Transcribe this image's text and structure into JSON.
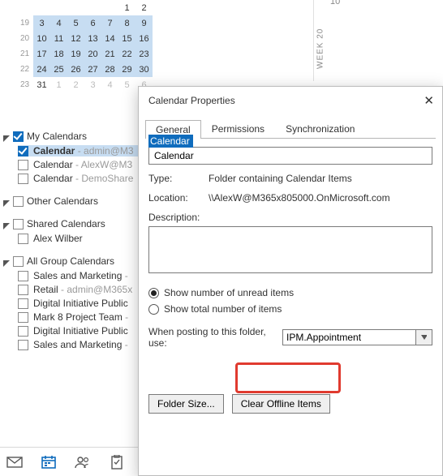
{
  "minical": {
    "weeks": [
      {
        "wk": "",
        "days": [
          "",
          "",
          "",
          "",
          "",
          "1",
          "2"
        ]
      },
      {
        "wk": "19",
        "days": [
          "3",
          "4",
          "5",
          "6",
          "7",
          "8",
          "9"
        ]
      },
      {
        "wk": "20",
        "days": [
          "10",
          "11",
          "12",
          "13",
          "14",
          "15",
          "16"
        ]
      },
      {
        "wk": "21",
        "days": [
          "17",
          "18",
          "19",
          "20",
          "21",
          "22",
          "23"
        ]
      },
      {
        "wk": "22",
        "days": [
          "24",
          "25",
          "26",
          "27",
          "28",
          "29",
          "30"
        ]
      },
      {
        "wk": "23",
        "days": [
          "31",
          "1",
          "2",
          "3",
          "4",
          "5",
          "6"
        ]
      }
    ]
  },
  "weekstrip": {
    "top_num": "10",
    "label": "WEEK 20"
  },
  "groups": {
    "my": {
      "title": "My Calendars",
      "items": [
        {
          "name": "Calendar",
          "sub": " - admin@M3",
          "checked": true,
          "sel": true
        },
        {
          "name": "Calendar",
          "sub": " - AlexW@M3",
          "checked": false,
          "sel": false
        },
        {
          "name": "Calendar",
          "sub": " - DemoShare",
          "checked": false,
          "sel": false
        }
      ]
    },
    "other": {
      "title": "Other Calendars",
      "items": []
    },
    "shared": {
      "title": "Shared Calendars",
      "items": [
        {
          "name": "Alex Wilber",
          "sub": "",
          "checked": false,
          "sel": false
        }
      ]
    },
    "allgroup": {
      "title": "All Group Calendars",
      "items": [
        {
          "name": "Sales and Marketing",
          "sub": " -",
          "checked": false
        },
        {
          "name": "Retail",
          "sub": " - admin@M365x",
          "checked": false
        },
        {
          "name": "Digital Initiative Public",
          "sub": "",
          "checked": false
        },
        {
          "name": "Mark 8 Project Team",
          "sub": " -",
          "checked": false
        },
        {
          "name": "Digital Initiative Public",
          "sub": "",
          "checked": false
        },
        {
          "name": "Sales and Marketing",
          "sub": " -",
          "checked": false
        }
      ]
    }
  },
  "dialog": {
    "title": "Calendar Properties",
    "tabs": {
      "general": "General",
      "permissions": "Permissions",
      "sync": "Synchronization"
    },
    "name_value": "Calendar",
    "type_label": "Type:",
    "type_value": "Folder containing Calendar Items",
    "loc_label": "Location:",
    "loc_value": "\\\\AlexW@M365x805000.OnMicrosoft.com",
    "desc_label": "Description:",
    "radio_unread": "Show number of unread items",
    "radio_total": "Show total number of items",
    "posting_label": "When posting to this folder, use:",
    "posting_value": "IPM.Appointment",
    "btn_folder": "Folder Size...",
    "btn_clear": "Clear Offline Items"
  }
}
